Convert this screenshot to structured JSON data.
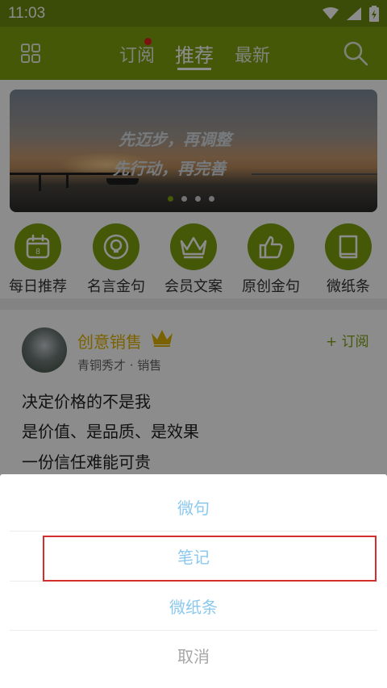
{
  "status_bar": {
    "time": "11:03"
  },
  "top_nav": {
    "tabs": [
      {
        "label": "订阅",
        "active": false,
        "has_notification_dot": true
      },
      {
        "label": "推荐",
        "active": true
      },
      {
        "label": "最新",
        "active": false
      }
    ]
  },
  "banner": {
    "line1": "先迈步，再调整",
    "line2": "先行动，再完善",
    "dots_total": 4,
    "active_dot": 1
  },
  "categories": [
    {
      "label": "每日推荐",
      "icon": "calendar-icon"
    },
    {
      "label": "名言金句",
      "icon": "lightbulb-icon"
    },
    {
      "label": "会员文案",
      "icon": "crown-icon"
    },
    {
      "label": "原创金句",
      "icon": "thumbs-up-icon"
    },
    {
      "label": "微纸条",
      "icon": "book-icon"
    }
  ],
  "post": {
    "author": "创意销售",
    "author_meta": "青铜秀才 · 销售",
    "subscribe_label": "+ 订阅",
    "lines": [
      "决定价格的不是我",
      "是价值、是品质、是效果",
      "一份信任难能可贵"
    ]
  },
  "sheet": {
    "items": [
      "微句",
      "笔记",
      "微纸条"
    ],
    "cancel_label": "取消",
    "highlighted_index": 1
  },
  "colors": {
    "accent": "#7ca010",
    "sheet_text": "#8bc8ee",
    "highlight": "#d32f2f",
    "author": "#e0b300"
  }
}
